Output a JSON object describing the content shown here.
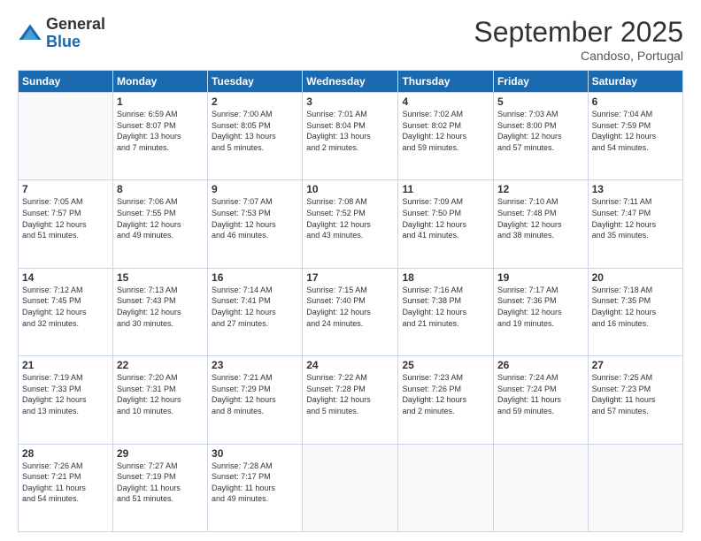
{
  "logo": {
    "general": "General",
    "blue": "Blue"
  },
  "title": "September 2025",
  "subtitle": "Candoso, Portugal",
  "days_of_week": [
    "Sunday",
    "Monday",
    "Tuesday",
    "Wednesday",
    "Thursday",
    "Friday",
    "Saturday"
  ],
  "weeks": [
    [
      {
        "day": "",
        "info": ""
      },
      {
        "day": "1",
        "info": "Sunrise: 6:59 AM\nSunset: 8:07 PM\nDaylight: 13 hours\nand 7 minutes."
      },
      {
        "day": "2",
        "info": "Sunrise: 7:00 AM\nSunset: 8:05 PM\nDaylight: 13 hours\nand 5 minutes."
      },
      {
        "day": "3",
        "info": "Sunrise: 7:01 AM\nSunset: 8:04 PM\nDaylight: 13 hours\nand 2 minutes."
      },
      {
        "day": "4",
        "info": "Sunrise: 7:02 AM\nSunset: 8:02 PM\nDaylight: 12 hours\nand 59 minutes."
      },
      {
        "day": "5",
        "info": "Sunrise: 7:03 AM\nSunset: 8:00 PM\nDaylight: 12 hours\nand 57 minutes."
      },
      {
        "day": "6",
        "info": "Sunrise: 7:04 AM\nSunset: 7:59 PM\nDaylight: 12 hours\nand 54 minutes."
      }
    ],
    [
      {
        "day": "7",
        "info": "Sunrise: 7:05 AM\nSunset: 7:57 PM\nDaylight: 12 hours\nand 51 minutes."
      },
      {
        "day": "8",
        "info": "Sunrise: 7:06 AM\nSunset: 7:55 PM\nDaylight: 12 hours\nand 49 minutes."
      },
      {
        "day": "9",
        "info": "Sunrise: 7:07 AM\nSunset: 7:53 PM\nDaylight: 12 hours\nand 46 minutes."
      },
      {
        "day": "10",
        "info": "Sunrise: 7:08 AM\nSunset: 7:52 PM\nDaylight: 12 hours\nand 43 minutes."
      },
      {
        "day": "11",
        "info": "Sunrise: 7:09 AM\nSunset: 7:50 PM\nDaylight: 12 hours\nand 41 minutes."
      },
      {
        "day": "12",
        "info": "Sunrise: 7:10 AM\nSunset: 7:48 PM\nDaylight: 12 hours\nand 38 minutes."
      },
      {
        "day": "13",
        "info": "Sunrise: 7:11 AM\nSunset: 7:47 PM\nDaylight: 12 hours\nand 35 minutes."
      }
    ],
    [
      {
        "day": "14",
        "info": "Sunrise: 7:12 AM\nSunset: 7:45 PM\nDaylight: 12 hours\nand 32 minutes."
      },
      {
        "day": "15",
        "info": "Sunrise: 7:13 AM\nSunset: 7:43 PM\nDaylight: 12 hours\nand 30 minutes."
      },
      {
        "day": "16",
        "info": "Sunrise: 7:14 AM\nSunset: 7:41 PM\nDaylight: 12 hours\nand 27 minutes."
      },
      {
        "day": "17",
        "info": "Sunrise: 7:15 AM\nSunset: 7:40 PM\nDaylight: 12 hours\nand 24 minutes."
      },
      {
        "day": "18",
        "info": "Sunrise: 7:16 AM\nSunset: 7:38 PM\nDaylight: 12 hours\nand 21 minutes."
      },
      {
        "day": "19",
        "info": "Sunrise: 7:17 AM\nSunset: 7:36 PM\nDaylight: 12 hours\nand 19 minutes."
      },
      {
        "day": "20",
        "info": "Sunrise: 7:18 AM\nSunset: 7:35 PM\nDaylight: 12 hours\nand 16 minutes."
      }
    ],
    [
      {
        "day": "21",
        "info": "Sunrise: 7:19 AM\nSunset: 7:33 PM\nDaylight: 12 hours\nand 13 minutes."
      },
      {
        "day": "22",
        "info": "Sunrise: 7:20 AM\nSunset: 7:31 PM\nDaylight: 12 hours\nand 10 minutes."
      },
      {
        "day": "23",
        "info": "Sunrise: 7:21 AM\nSunset: 7:29 PM\nDaylight: 12 hours\nand 8 minutes."
      },
      {
        "day": "24",
        "info": "Sunrise: 7:22 AM\nSunset: 7:28 PM\nDaylight: 12 hours\nand 5 minutes."
      },
      {
        "day": "25",
        "info": "Sunrise: 7:23 AM\nSunset: 7:26 PM\nDaylight: 12 hours\nand 2 minutes."
      },
      {
        "day": "26",
        "info": "Sunrise: 7:24 AM\nSunset: 7:24 PM\nDaylight: 11 hours\nand 59 minutes."
      },
      {
        "day": "27",
        "info": "Sunrise: 7:25 AM\nSunset: 7:23 PM\nDaylight: 11 hours\nand 57 minutes."
      }
    ],
    [
      {
        "day": "28",
        "info": "Sunrise: 7:26 AM\nSunset: 7:21 PM\nDaylight: 11 hours\nand 54 minutes."
      },
      {
        "day": "29",
        "info": "Sunrise: 7:27 AM\nSunset: 7:19 PM\nDaylight: 11 hours\nand 51 minutes."
      },
      {
        "day": "30",
        "info": "Sunrise: 7:28 AM\nSunset: 7:17 PM\nDaylight: 11 hours\nand 49 minutes."
      },
      {
        "day": "",
        "info": ""
      },
      {
        "day": "",
        "info": ""
      },
      {
        "day": "",
        "info": ""
      },
      {
        "day": "",
        "info": ""
      }
    ]
  ]
}
